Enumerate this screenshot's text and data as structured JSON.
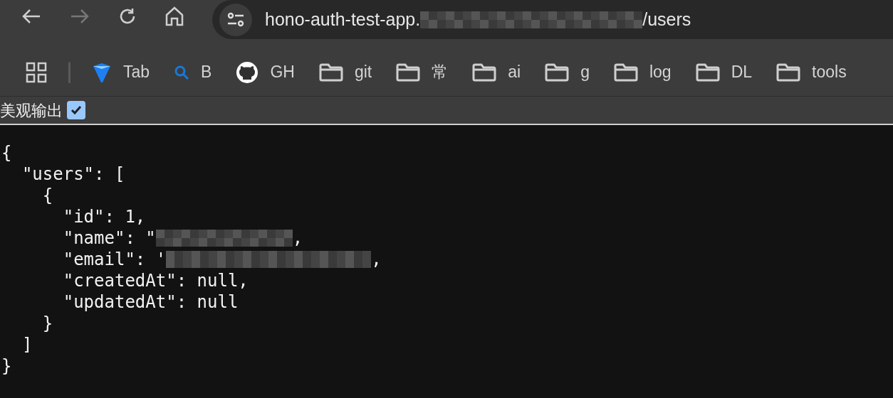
{
  "nav": {
    "back": {
      "disabled": false
    },
    "forward": {
      "disabled": true
    }
  },
  "address_bar": {
    "url_parts": [
      {
        "kind": "text",
        "text": "hono-auth-test-app."
      },
      {
        "kind": "redacted"
      },
      {
        "kind": "text",
        "text": "/users"
      }
    ]
  },
  "bookmarks": [
    {
      "kind": "site",
      "label": "Tab"
    },
    {
      "kind": "site",
      "label": "B"
    },
    {
      "kind": "site",
      "label": "GH"
    },
    {
      "kind": "folder",
      "label": "git"
    },
    {
      "kind": "folder",
      "label": "常"
    },
    {
      "kind": "folder",
      "label": "ai"
    },
    {
      "kind": "folder",
      "label": "g"
    },
    {
      "kind": "folder",
      "label": "log"
    },
    {
      "kind": "folder",
      "label": "DL"
    },
    {
      "kind": "folder",
      "label": "tools"
    }
  ],
  "pretty_print": {
    "label": "美观输出",
    "checked": true
  },
  "code_lines": [
    {
      "parts": [
        {
          "kind": "text",
          "text": "{"
        }
      ]
    },
    {
      "parts": [
        {
          "kind": "text",
          "text": "  \"users\": ["
        }
      ]
    },
    {
      "parts": [
        {
          "kind": "text",
          "text": "    {"
        }
      ]
    },
    {
      "parts": [
        {
          "kind": "text",
          "text": "      \"id\": 1,"
        }
      ]
    },
    {
      "parts": [
        {
          "kind": "text",
          "text": "      \"name\": \""
        },
        {
          "kind": "redacted"
        },
        {
          "kind": "text",
          "text": ","
        }
      ]
    },
    {
      "parts": [
        {
          "kind": "text",
          "text": "      \"email\": '"
        },
        {
          "kind": "redacted"
        },
        {
          "kind": "text",
          "text": ","
        }
      ]
    },
    {
      "parts": [
        {
          "kind": "text",
          "text": "      \"createdAt\": null,"
        }
      ]
    },
    {
      "parts": [
        {
          "kind": "text",
          "text": "      \"updatedAt\": null"
        }
      ]
    },
    {
      "parts": [
        {
          "kind": "text",
          "text": "    }"
        }
      ]
    },
    {
      "parts": [
        {
          "kind": "text",
          "text": "  ]"
        }
      ]
    },
    {
      "parts": [
        {
          "kind": "text",
          "text": "}"
        }
      ]
    }
  ]
}
